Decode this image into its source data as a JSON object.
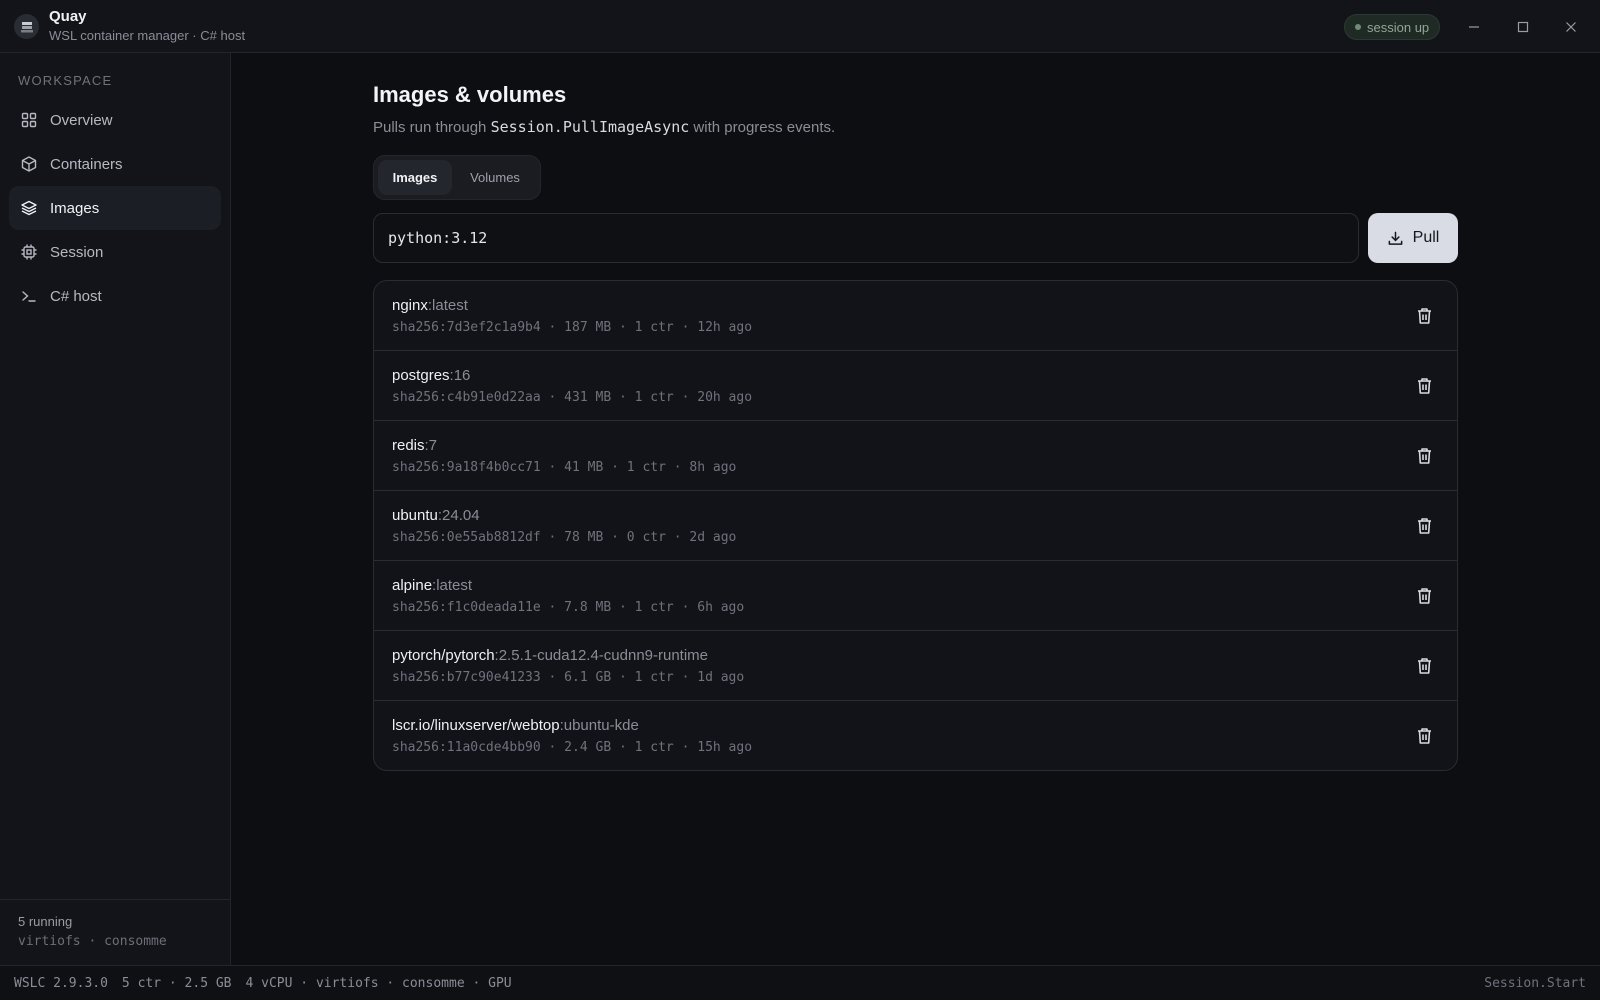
{
  "app": {
    "title": "Quay",
    "subtitle": "WSL container manager · C# host",
    "session_status": "session up"
  },
  "sidebar": {
    "section_label": "WORKSPACE",
    "items": [
      {
        "label": "Overview",
        "icon": "grid-icon",
        "active": false
      },
      {
        "label": "Containers",
        "icon": "box-icon",
        "active": false
      },
      {
        "label": "Images",
        "icon": "layers-icon",
        "active": true
      },
      {
        "label": "Session",
        "icon": "chip-icon",
        "active": false
      },
      {
        "label": "C# host",
        "icon": "terminal-icon",
        "active": false
      }
    ],
    "footer": {
      "running": "5 running",
      "meta": "virtiofs · consomme"
    }
  },
  "main": {
    "title": "Images & volumes",
    "description_prefix": "Pulls run through ",
    "description_code": "Session.PullImageAsync",
    "description_suffix": " with progress events.",
    "tabs": [
      {
        "label": "Images",
        "active": true
      },
      {
        "label": "Volumes",
        "active": false
      }
    ],
    "pull": {
      "value": "python:3.12",
      "placeholder": "",
      "button_label": "Pull"
    },
    "images": [
      {
        "repo": "nginx",
        "tag": ":latest",
        "meta": "sha256:7d3ef2c1a9b4 · 187 MB · 1 ctr · 12h ago"
      },
      {
        "repo": "postgres",
        "tag": ":16",
        "meta": "sha256:c4b91e0d22aa · 431 MB · 1 ctr · 20h ago"
      },
      {
        "repo": "redis",
        "tag": ":7",
        "meta": "sha256:9a18f4b0cc71 · 41 MB · 1 ctr · 8h ago"
      },
      {
        "repo": "ubuntu",
        "tag": ":24.04",
        "meta": "sha256:0e55ab8812df · 78 MB · 0 ctr · 2d ago"
      },
      {
        "repo": "alpine",
        "tag": ":latest",
        "meta": "sha256:f1c0deada11e · 7.8 MB · 1 ctr · 6h ago"
      },
      {
        "repo": "pytorch/pytorch",
        "tag": ":2.5.1-cuda12.4-cudnn9-runtime",
        "meta": "sha256:b77c90e41233 · 6.1 GB · 1 ctr · 1d ago"
      },
      {
        "repo": "lscr.io/linuxserver/webtop",
        "tag": ":ubuntu-kde",
        "meta": "sha256:11a0cde4bb90 · 2.4 GB · 1 ctr · 15h ago"
      }
    ]
  },
  "statusbar": {
    "version": "WSLC 2.9.3.0",
    "usage": "5 ctr · 2.5 GB",
    "resources": "4 vCPU · virtiofs · consomme · GPU",
    "right": "Session.Start"
  },
  "colors": {
    "background": "#0d0e12",
    "panel": "#131419",
    "accent_button": "#d9dce4",
    "session_dot": "#6f8b78"
  }
}
